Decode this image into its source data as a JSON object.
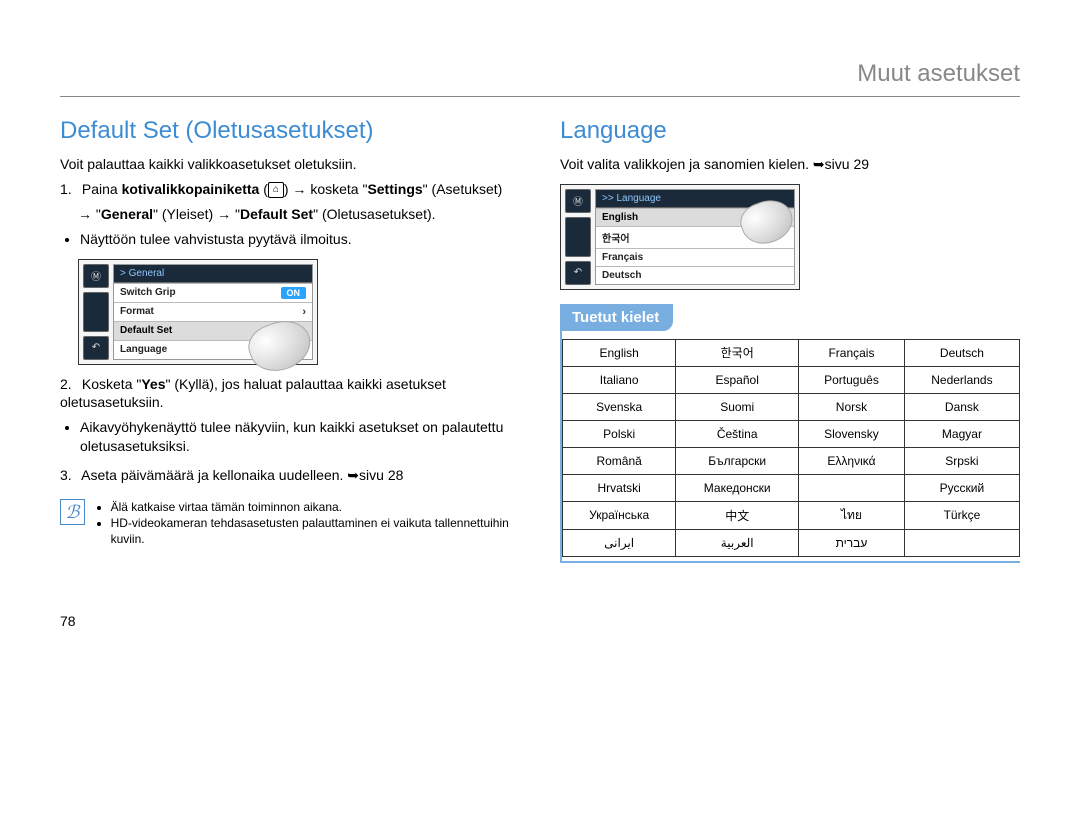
{
  "header": {
    "title": "Muut asetukset"
  },
  "page_number": "78",
  "left": {
    "title": "Default Set (Oletusasetukset)",
    "intro": "Voit palauttaa kaikki valikkoasetukset oletuksiin.",
    "step1_pre": "Paina ",
    "step1_bold1": "kotivalikkopainiketta",
    "step1_home": " (",
    "step1_home_close": ") → kosketa \"",
    "step1_bold2": "Settings",
    "step1_after2": "\" (Asetukset)",
    "step1_line2_start": "→ \"",
    "step1_bold3": "General",
    "step1_after3": "\" (Yleiset) → \"",
    "step1_bold4": "Default Set",
    "step1_after4": "\" (Oletusasetukset).",
    "step1_bullet": "Näyttöön tulee vahvistusta pyytävä ilmoitus.",
    "fig_header": "> General",
    "fig_items": [
      "Switch Grip",
      "Format",
      "Default Set",
      "Language"
    ],
    "step2_pre": "Kosketa \"",
    "step2_bold": "Yes",
    "step2_post": "\" (Kyllä), jos haluat palauttaa kaikki asetukset oletusasetuksiin.",
    "step2_bullet": "Aikavyöhykenäyttö tulee näkyviin, kun kaikki asetukset on palautettu oletusasetuksiksi.",
    "step3": "Aseta päivämäärä ja kellonaika uudelleen. ",
    "step3_ref": "sivu 28",
    "notes": [
      "Älä katkaise virtaa tämän toiminnon aikana.",
      "HD-videokameran tehdasasetusten palauttaminen ei vaikuta tallennettuihin kuviin."
    ]
  },
  "right": {
    "title": "Language",
    "intro": "Voit valita valikkojen ja sanomien kielen. ",
    "intro_ref": "sivu 29",
    "fig_header": ">> Language",
    "fig_items": [
      "English",
      "한국어",
      "Français",
      "Deutsch"
    ],
    "table_title": "Tuetut kielet",
    "table_rows": [
      [
        "English",
        "한국어",
        "Français",
        "Deutsch"
      ],
      [
        "Italiano",
        "Español",
        "Português",
        "Nederlands"
      ],
      [
        "Svenska",
        "Suomi",
        "Norsk",
        "Dansk"
      ],
      [
        "Polski",
        "Čeština",
        "Slovensky",
        "Magyar"
      ],
      [
        "Română",
        "Български",
        "Ελληνικά",
        "Srpski"
      ],
      [
        "Hrvatski",
        "Македонски",
        "",
        "Русский"
      ],
      [
        "Українська",
        "中文",
        "ไทย",
        "Türkçe"
      ],
      [
        "ایرانی",
        "العربية",
        "עברית",
        ""
      ]
    ]
  }
}
